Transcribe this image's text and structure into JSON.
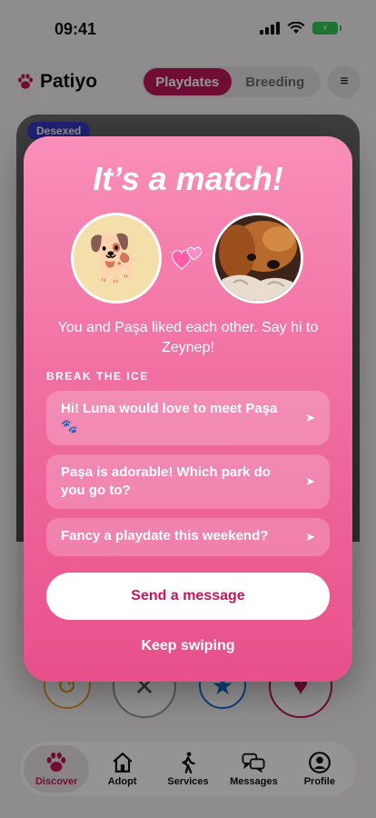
{
  "status": {
    "time": "09:41"
  },
  "header": {
    "brand": "Patiyo",
    "tabs": [
      "Playdates",
      "Breeding"
    ],
    "active_tab": "Playdates",
    "menu_icon": "≡"
  },
  "card": {
    "badge": "Desexed"
  },
  "colors": {
    "accent": "#c2185b",
    "modal_top": "#f98fb8",
    "modal_bottom": "#e8508a"
  },
  "match": {
    "title": "It’s a match!",
    "left_pet_emoji": "🐕",
    "message": "You and Paşa liked each other. Say hi to Zeynep!",
    "icebreaker_label": "BREAK THE ICE",
    "icebreakers": [
      "Hi! Luna would love to meet Paşa 🐾",
      "Paşa is adorable! Which park do you go to?",
      "Fancy a playdate this weekend?"
    ],
    "send_icon": "➤",
    "send_button": "Send a message",
    "keep_swiping": "Keep swiping"
  },
  "tab_bar": {
    "items": [
      {
        "label": "Discover",
        "icon": "paw-icon"
      },
      {
        "label": "Adopt",
        "icon": "house-icon"
      },
      {
        "label": "Services",
        "icon": "walker-icon"
      },
      {
        "label": "Messages",
        "icon": "chat-bubbles-icon"
      },
      {
        "label": "Profile",
        "icon": "person-icon"
      }
    ],
    "active": "Discover"
  }
}
